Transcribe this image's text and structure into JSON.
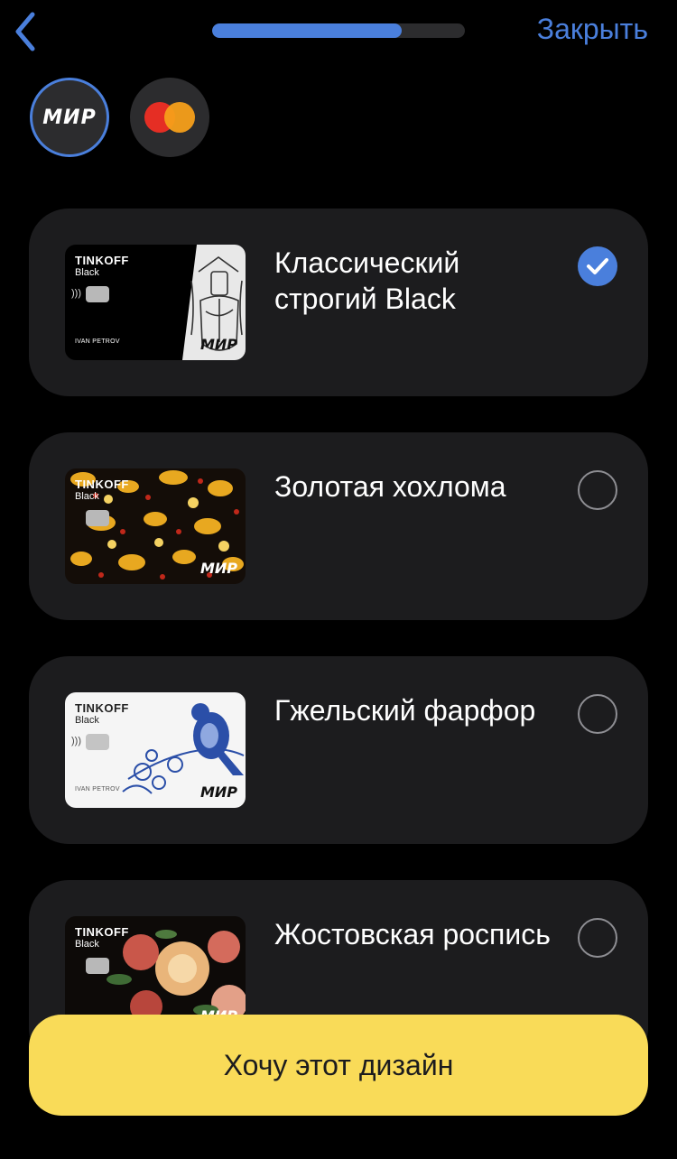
{
  "header": {
    "close_label": "Закрыть",
    "progress": 0.75
  },
  "payment_systems": [
    {
      "name": "МИР",
      "selected": true
    },
    {
      "name": "Mastercard",
      "selected": false
    }
  ],
  "designs": [
    {
      "title": "Классический строгий Black",
      "selected": true,
      "card": {
        "brand": "TINKOFF",
        "tier": "Black",
        "holder": "IVAN PETROV",
        "system": "МИР"
      }
    },
    {
      "title": "Золотая хохлома",
      "selected": false,
      "card": {
        "brand": "TINKOFF",
        "tier": "Black",
        "system": "МИР"
      }
    },
    {
      "title": "Гжельский фарфор",
      "selected": false,
      "card": {
        "brand": "TINKOFF",
        "tier": "Black",
        "holder": "IVAN PETROV",
        "system": "МИР"
      }
    },
    {
      "title": "Жостовская роспись",
      "selected": false,
      "card": {
        "brand": "TINKOFF",
        "tier": "Black",
        "system": "МИР"
      }
    }
  ],
  "cta": {
    "label": "Хочу этот дизайн"
  },
  "colors": {
    "accent": "#4a7fdc",
    "cta": "#f9db58",
    "row_bg": "#1c1c1e",
    "bg": "#000000"
  }
}
